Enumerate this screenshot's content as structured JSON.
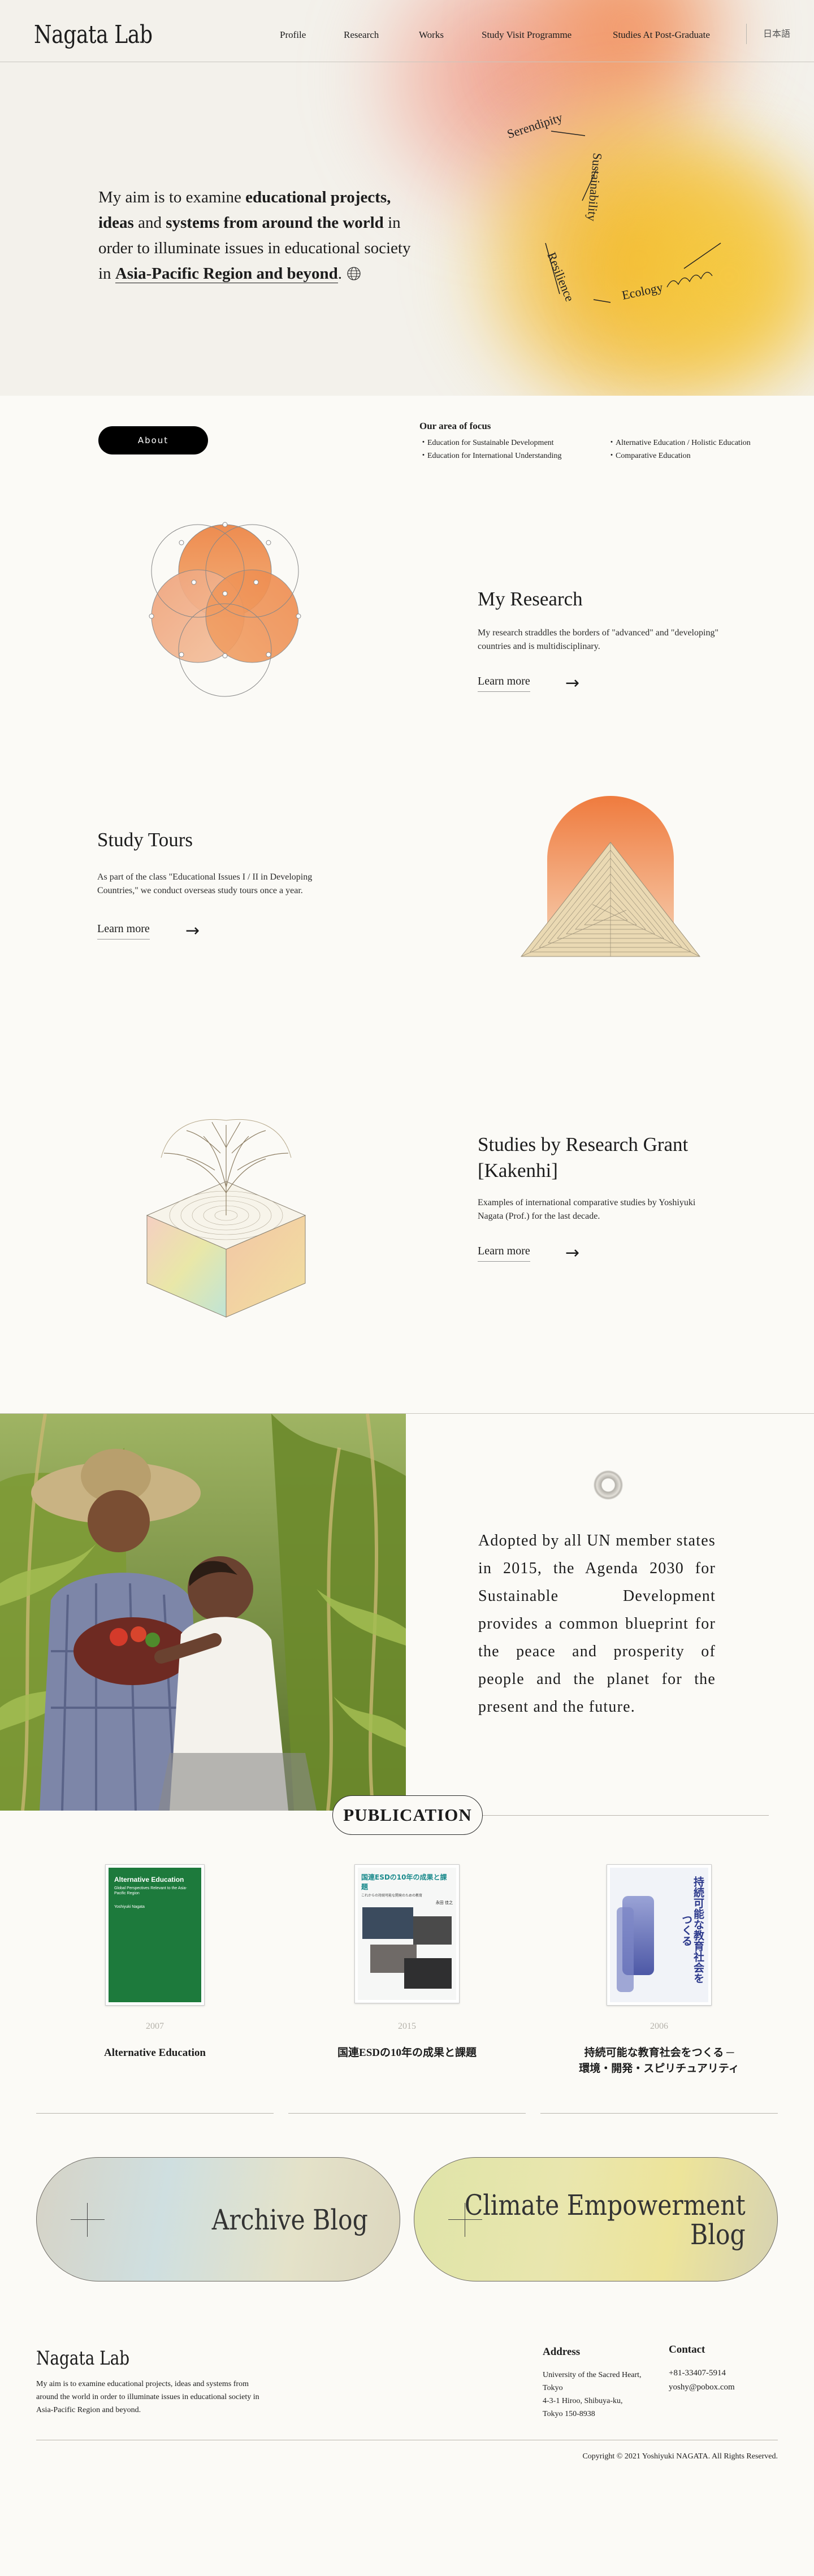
{
  "site": {
    "logo": "Nagata Lab",
    "nav": [
      "Profile",
      "Research",
      "Works",
      "Study Visit Programme",
      "Studies At Post-Graduate"
    ],
    "lang": "日本語"
  },
  "hero": {
    "line1a": "My aim is to examine ",
    "line1b": "educational projects,",
    "line2a": "ideas",
    "line2b": " and ",
    "line2c": "systems from around the world",
    "line2d": " in",
    "line3": "order to illuminate issues in educational society",
    "line4a": "in ",
    "line4b": "Asia-Pacific Region and beyond",
    "line4c": ".",
    "words": [
      "Serendipity",
      "Sustainability",
      "Resilience",
      "Ecology"
    ]
  },
  "about": {
    "button": "About",
    "focus_title": "Our area of focus",
    "focus_col1": [
      "・Education for Sustainable Development",
      "・Education for International Understanding"
    ],
    "focus_col2": [
      "・Alternative Education / Holistic Education",
      "・Comparative Education"
    ]
  },
  "research": {
    "title": "My Research",
    "desc": "My research straddles the borders of \"advanced\" and \"developing\" countries and is multidisciplinary.",
    "more": "Learn more"
  },
  "tours": {
    "title": "Study Tours",
    "desc": "As part of the class \"Educational Issues I / II in Developing Countries,\" we conduct overseas study tours once a year.",
    "more": "Learn more"
  },
  "grant": {
    "title_1": "Studies by Research Grant",
    "title_2": "[Kakenhi]",
    "desc": "Examples of international comparative studies by Yoshiyuki Nagata (Prof.) for the last decade.",
    "more": "Learn more"
  },
  "sdg": {
    "text": "Adopted by all UN member states in 2015, the Agenda 2030 for Sustainable Development provides a common blueprint for the peace and prosperity of people and the planet for the present and the future."
  },
  "publication": {
    "heading": "PUBLICATION",
    "books": [
      {
        "year": "2007",
        "title": "Alternative Education",
        "cover_title": "Alternative Education",
        "cover_sub": "Global Perspectives Relevant to the Asia-Pacific Region",
        "cover_author": "Yoshiyuki Nagata"
      },
      {
        "year": "2015",
        "title": "国連ESDの10年の成果と課題",
        "cover_title": "国連ESDの10年の成果と課題",
        "cover_sub": "これからの持続可能な開発のための教育",
        "cover_author": "永田 佳之"
      },
      {
        "year": "2006",
        "title": "持続可能な教育社会をつくる ─ 環境・開発・スピリチュアリティ",
        "title_1": "持続可能な教育社会をつくる ─",
        "title_2": "環境・開発・スピリチュアリティ",
        "cover_title": "持続可能な教育社会をつくる"
      }
    ]
  },
  "blogs": {
    "archive": "Archive Blog",
    "climate_1": "Climate Empowerment",
    "climate_2": "Blog"
  },
  "footer": {
    "logo": "Nagata Lab",
    "about": "My aim is to examine educational projects, ideas and systems from around the world in order to illuminate issues in educational society in Asia-Pacific Region and beyond.",
    "address_title": "Address",
    "address": [
      "University of the Sacred Heart, Tokyo",
      "4-3-1 Hiroo, Shibuya-ku,",
      "Tokyo 150-8938"
    ],
    "contact_title": "Contact",
    "phone": "+81-33407-5914",
    "email": "yoshy@pobox.com",
    "copyright": "Copyright © 2021 Yoshiyuki NAGATA. All Rights Reserved."
  },
  "colors": {
    "background": "#fbfaf6",
    "orange": "#f2884f",
    "yellow": "#f3b41d",
    "pink": "#f09a86",
    "book_green": "#1d7a3c",
    "book_teal": "#1a8a8c"
  }
}
